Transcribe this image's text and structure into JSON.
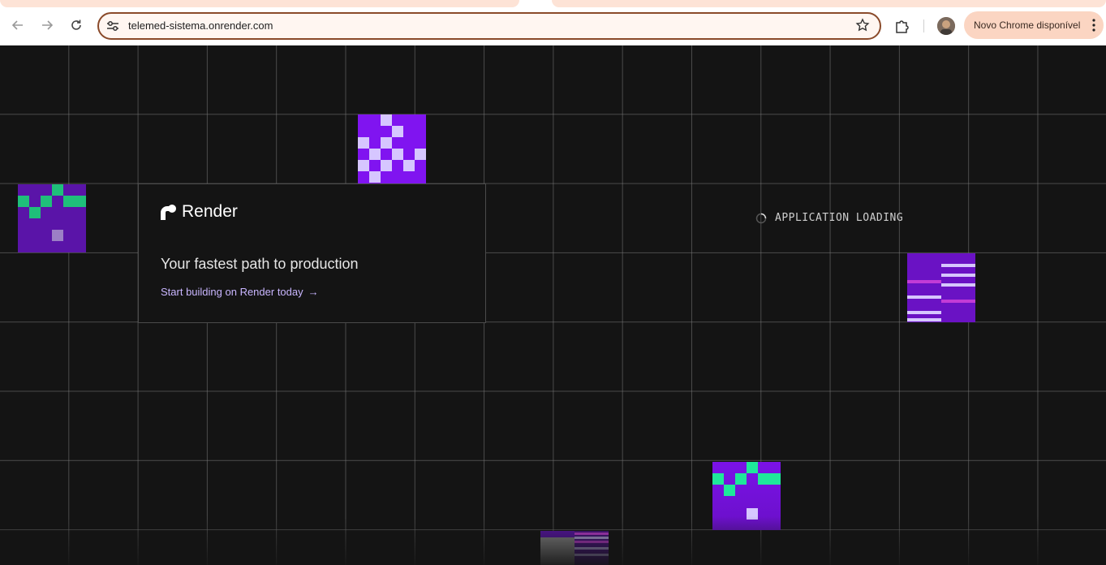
{
  "browser": {
    "url": "telemed-sistema.onrender.com",
    "update_label": "Novo Chrome disponível",
    "icons": {
      "back": "arrow-left-icon",
      "forward": "arrow-right-icon",
      "reload": "reload-icon",
      "site_info": "tune-icon",
      "bookmark": "star-icon",
      "extensions": "puzzle-icon",
      "menu": "more-vertical-icon"
    }
  },
  "card": {
    "brand": "Render",
    "headline": "Your fastest path to production",
    "cta": "Start building on Render today",
    "cta_arrow": "→"
  },
  "loading": {
    "text": "APPLICATION LOADING"
  },
  "colors": {
    "background": "#141414",
    "purple": "#8014f0",
    "green": "#1fbf7a",
    "lavender": "#d6c6ff",
    "magenta": "#c23bd6",
    "cta": "#c9b6ff"
  }
}
